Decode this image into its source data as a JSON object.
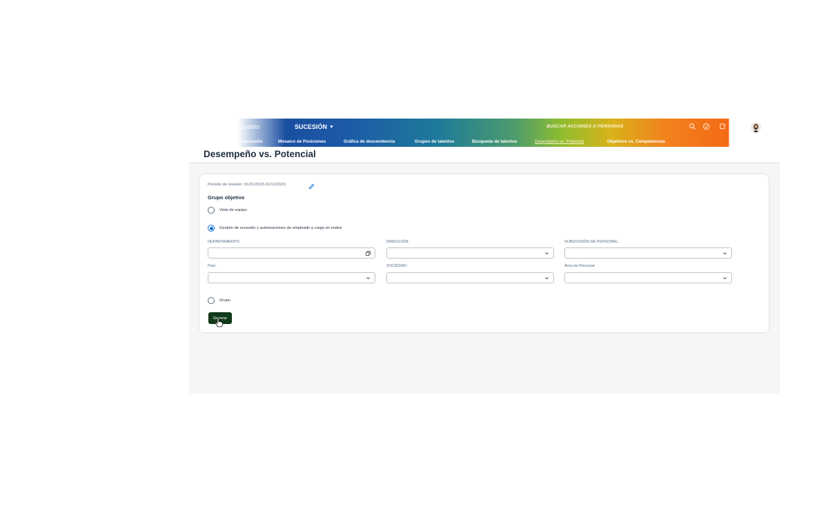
{
  "shell": {
    "logo_text": "pueblo",
    "module_label": "SUCESIÓN",
    "search_text": "BUSCAR ACCIONES O PERSONAS"
  },
  "nav": {
    "items": [
      {
        "label": "e sucesión"
      },
      {
        "label": "Mosaico de Posiciones"
      },
      {
        "label": "Gráfica de descendencia"
      },
      {
        "label": "Grupos de talentos"
      },
      {
        "label": "Búsqueda de talentos"
      },
      {
        "label": "Desempeño vs. Potencial",
        "active": true
      },
      {
        "label": "Objetivos vs. Competencias"
      }
    ]
  },
  "page": {
    "title": "Desempeño vs. Potencial"
  },
  "form": {
    "period": "Periodo de revisión: 01/01/2023-31/12/2023",
    "group_title": "Grupo objetivo",
    "options": [
      {
        "label": "Vista de equipo",
        "checked": false
      },
      {
        "label": "Gestión de sucesión y autorizaciones de empleado a cargo en matriz",
        "checked": true
      },
      {
        "label": "Grupo",
        "checked": false
      }
    ],
    "fields": [
      {
        "label": "DEPARTAMENTO:",
        "value": "",
        "icon": "value-help-icon"
      },
      {
        "label": "DIRECCIÓN:",
        "value": "",
        "icon": "chevron-down-icon"
      },
      {
        "label": "SUBDIVISIÓN DE PERSONAL:",
        "value": "",
        "icon": "chevron-down-icon"
      },
      {
        "label": "País:",
        "value": "",
        "icon": "chevron-down-icon"
      },
      {
        "label": "SOCIEDAD:",
        "value": "",
        "icon": "chevron-down-icon"
      },
      {
        "label": "Área de Personal:",
        "value": "",
        "icon": "chevron-down-icon"
      }
    ],
    "generate_label": "Generar"
  },
  "colors": {
    "accent": "#0a6ed1",
    "button": "#0f3b1a",
    "shell_orange": "#f46a16"
  }
}
